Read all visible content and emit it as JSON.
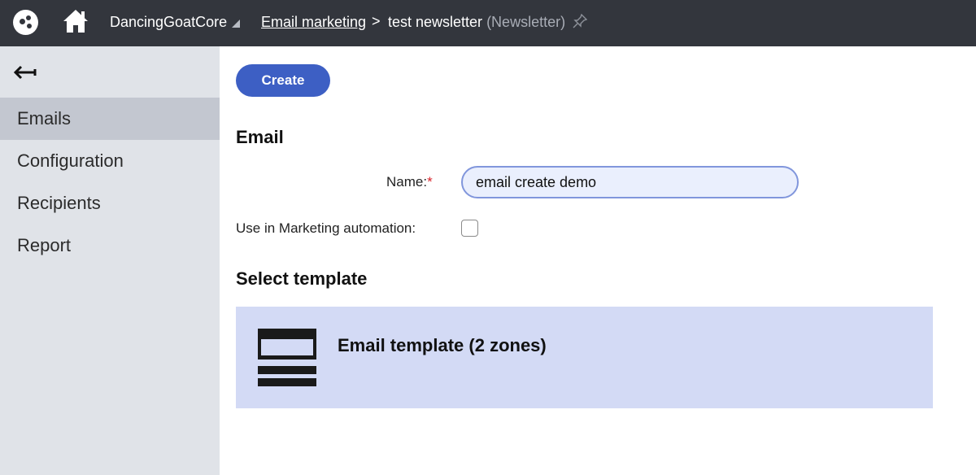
{
  "header": {
    "site_name": "DancingGoatCore",
    "breadcrumb_link": "Email marketing",
    "breadcrumb_separator": ">",
    "breadcrumb_current": "test newsletter",
    "breadcrumb_type": "(Newsletter)",
    "icons": [
      "app-logo-icon",
      "home-icon",
      "dropdown-triangle-icon",
      "pin-icon"
    ]
  },
  "sidebar": {
    "back_icon": "back-arrow-icon",
    "items": [
      {
        "label": "Emails",
        "active": true
      },
      {
        "label": "Configuration",
        "active": false
      },
      {
        "label": "Recipients",
        "active": false
      },
      {
        "label": "Report",
        "active": false
      }
    ]
  },
  "main": {
    "create_label": "Create",
    "email_heading": "Email",
    "name_label": "Name:",
    "name_required_mark": "*",
    "name_value": "email create demo",
    "automation_label": "Use in Marketing automation:",
    "automation_checked": false,
    "select_template_heading": "Select template",
    "template_name": "Email template (2 zones)"
  },
  "colors": {
    "topbar": "#33363d",
    "sidebar": "#e0e3e8",
    "sidebar_active": "#c3c7d0",
    "primary": "#3d5fc4",
    "template_card": "#d3daf5",
    "required": "#d8232a"
  }
}
